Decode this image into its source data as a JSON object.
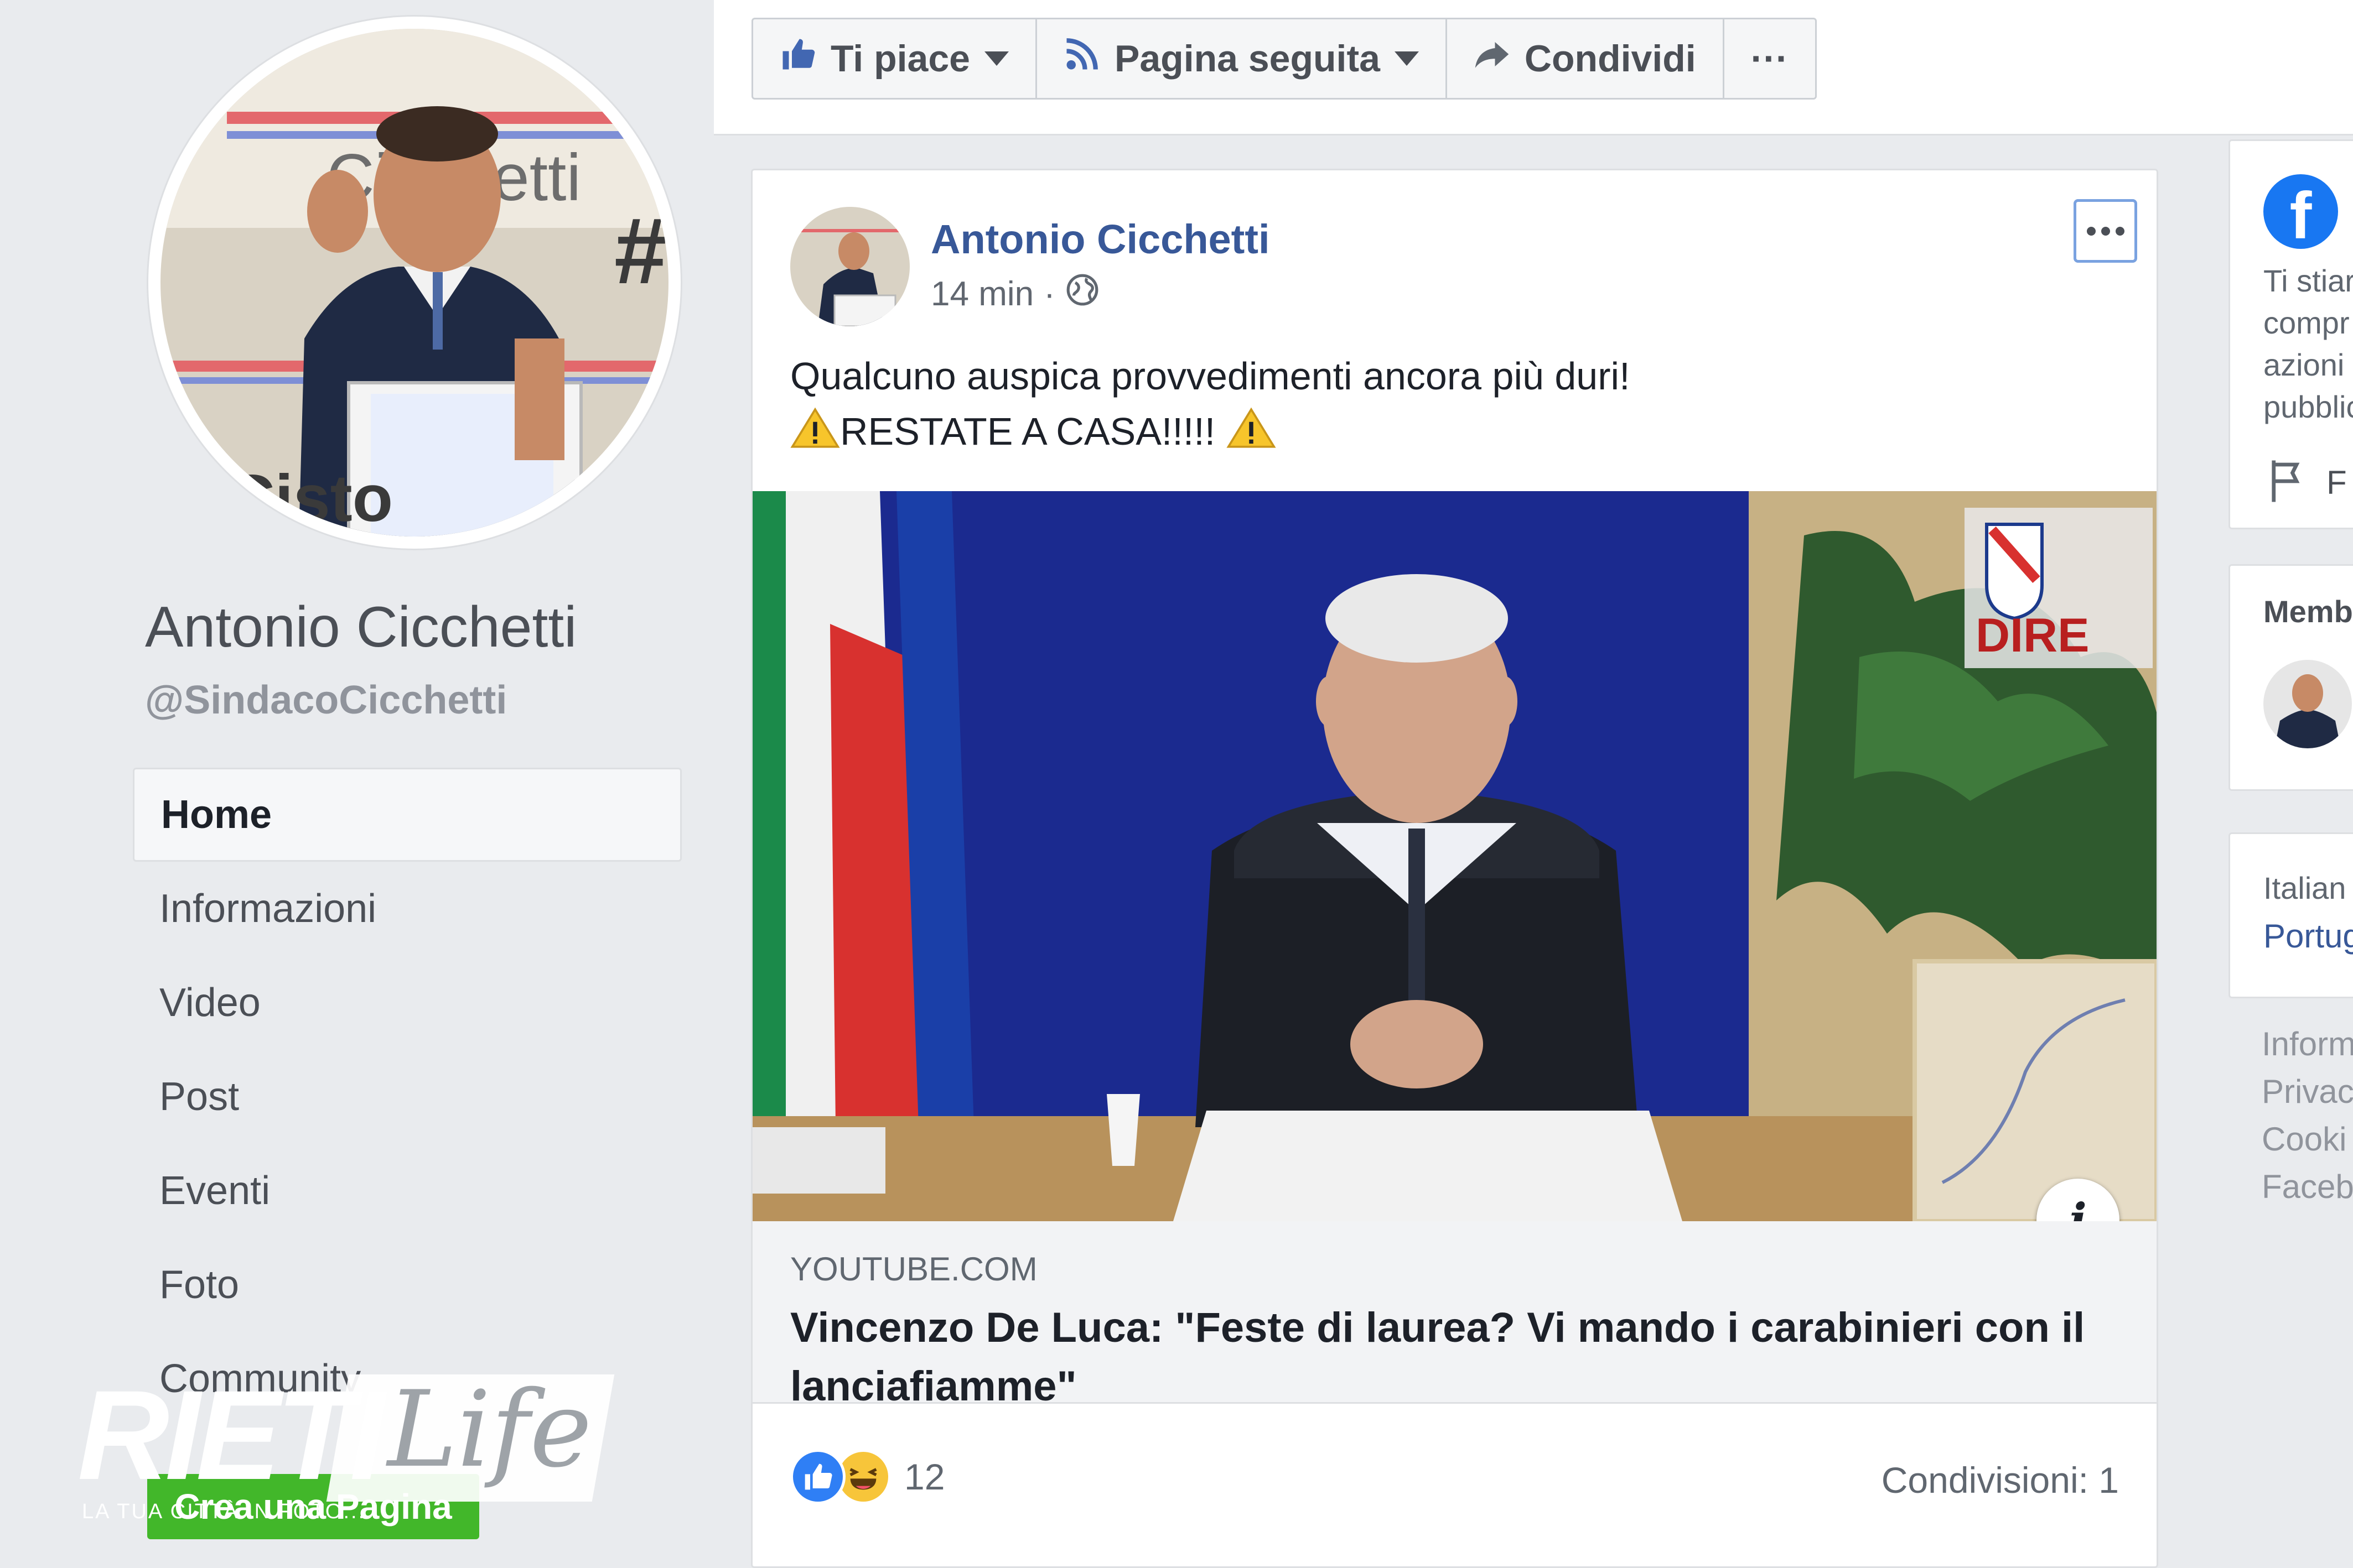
{
  "profile": {
    "name": "Antonio Cicchetti",
    "handle": "@SindacoCicchetti",
    "photo_banner_text": "Cicchetti",
    "podium_text": "Cisto"
  },
  "sidebar": {
    "items": [
      {
        "label": "Home"
      },
      {
        "label": "Informazioni"
      },
      {
        "label": "Video"
      },
      {
        "label": "Post"
      },
      {
        "label": "Eventi"
      },
      {
        "label": "Foto"
      },
      {
        "label": "Community"
      }
    ],
    "create_page_label": "Crea una Pagina"
  },
  "action_bar": {
    "like_label": "Ti piace",
    "follow_label": "Pagina seguita",
    "share_label": "Condividi",
    "more_label": "···"
  },
  "post": {
    "author": "Antonio Cicchetti",
    "time": "14 min",
    "separator": "·",
    "text_line1": "Qualcuno auspica provvedimenti ancora più duri!",
    "text_line2": "RESTATE A CASA!!!!! ",
    "video_logo_text": "DIRE",
    "link_domain": "YOUTUBE.COM",
    "link_title": "Vincenzo De Luca: \"Feste di laurea? Vi mando i carabinieri con il lanciafiamme\"",
    "info_label": "i",
    "reaction_count": "12",
    "shares": "Condivisioni: 1"
  },
  "right_panel": {
    "card1_lines": [
      "Ti stiar",
      "compr",
      "azioni",
      "pubblic"
    ],
    "card1_action": "F",
    "members_label": "Memb",
    "lang_current": "Italian",
    "lang_link": "Portug",
    "footer_links": [
      "Inform",
      "Privac",
      "Cooki",
      "Faceb"
    ]
  },
  "watermark": {
    "brand": "RIETI",
    "script": "Life",
    "tagline": "LA TUA CITTÀ IN FOTO..."
  },
  "colors": {
    "background": "#e9ebee",
    "facebook_blue": "#385898",
    "facebook_logo": "#1877f2",
    "create_page_green": "#42b72a",
    "video_background": "#1b2a8f"
  }
}
